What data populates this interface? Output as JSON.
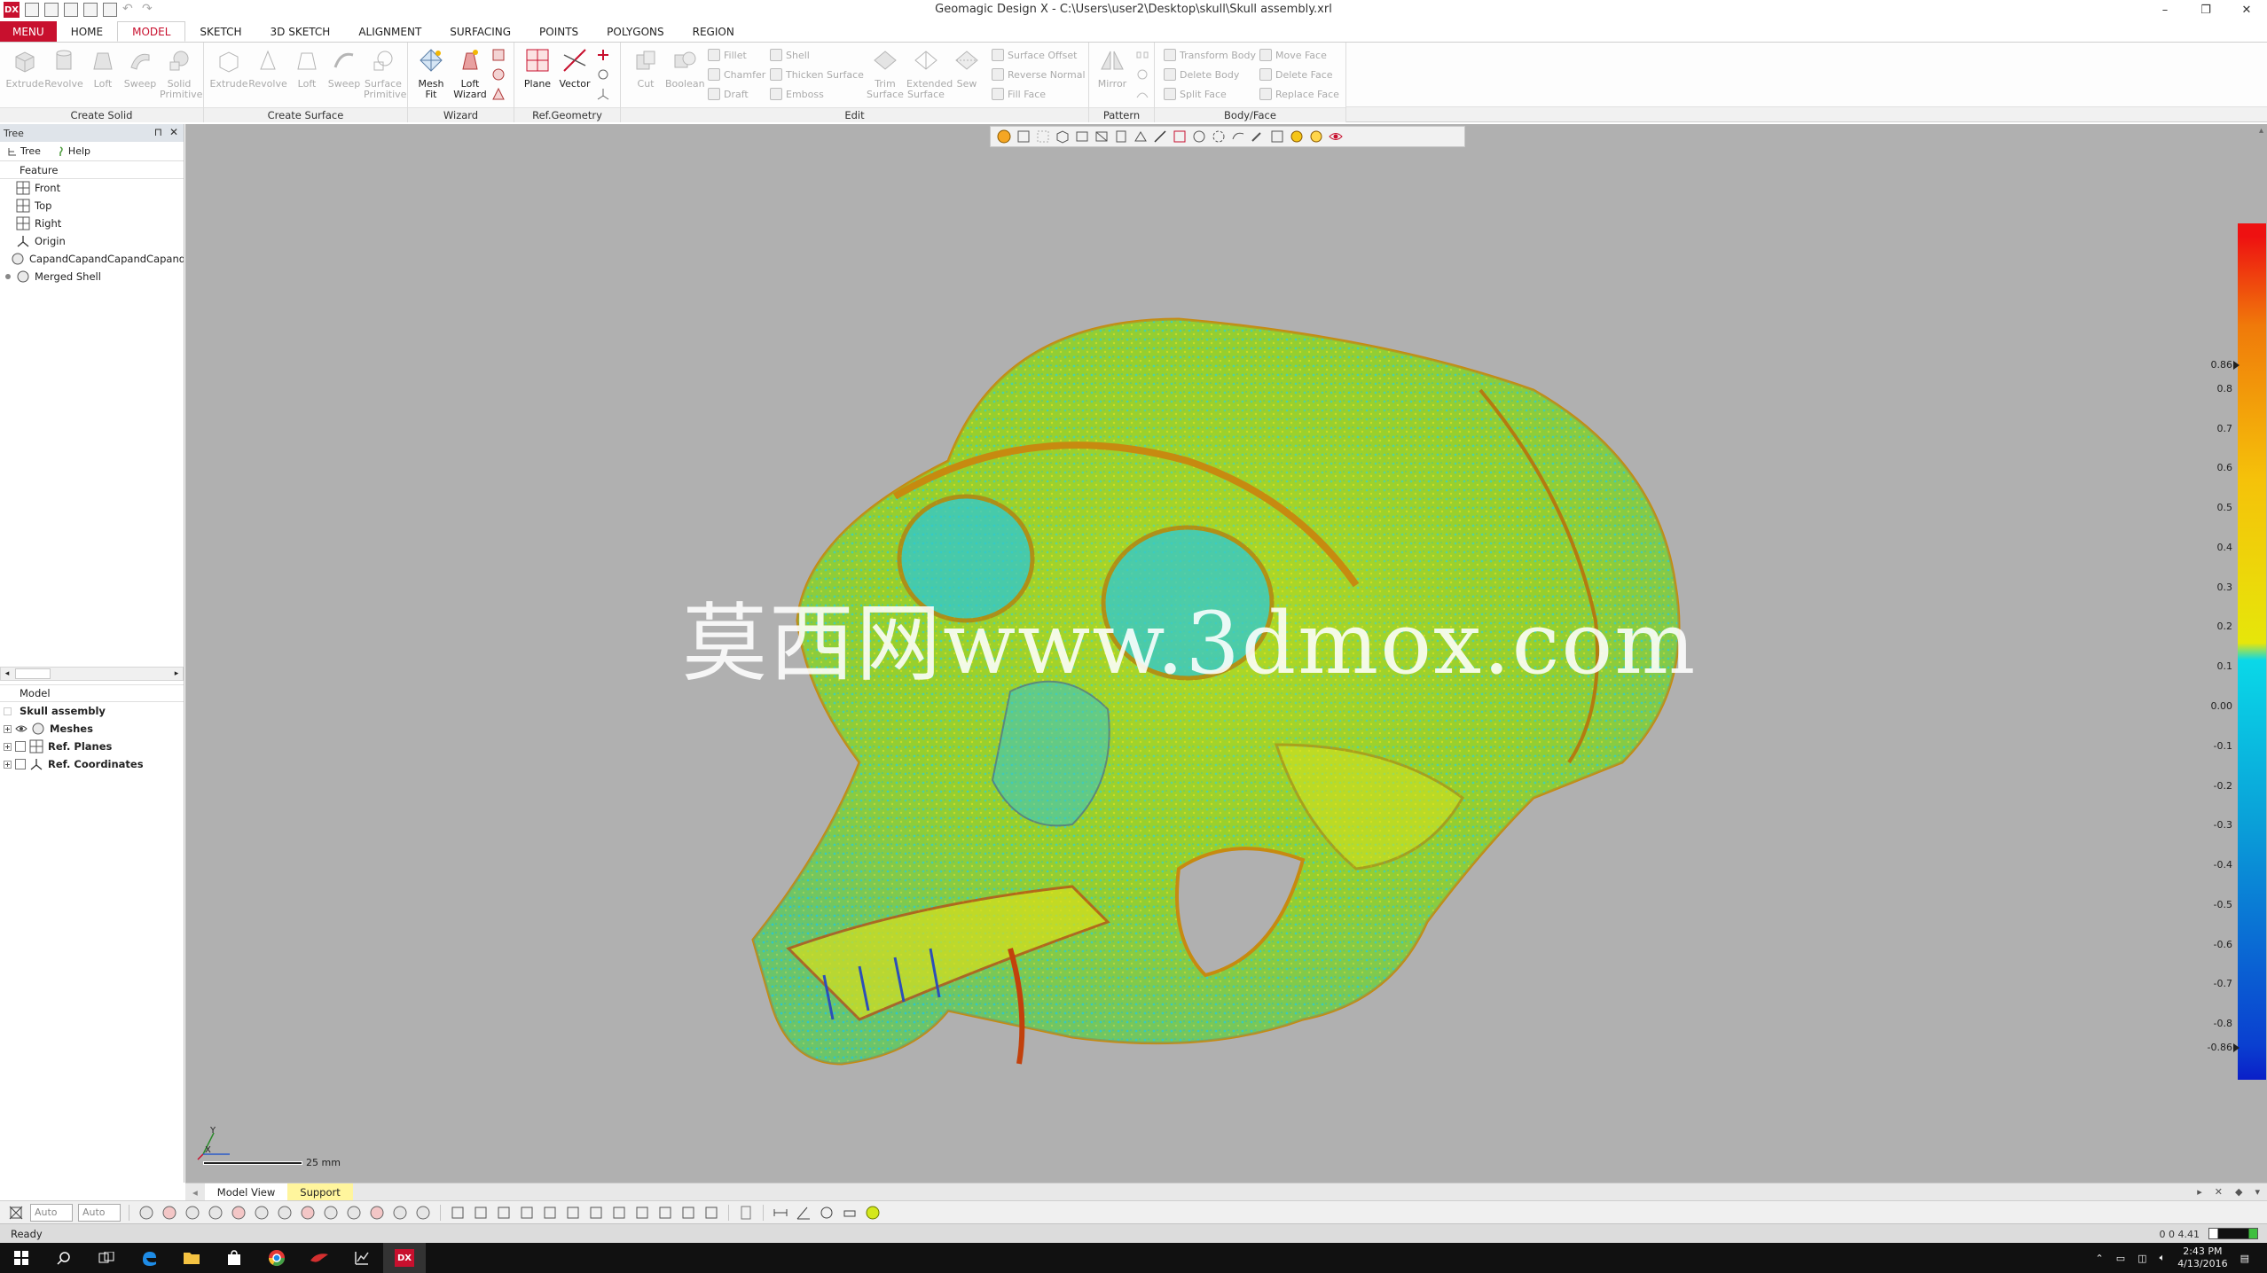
{
  "window": {
    "title": "Geomagic Design X - C:\\Users\\user2\\Desktop\\skull\\Skull assembly.xrl",
    "logo": "DX",
    "minimize": "–",
    "maximize": "❐",
    "close": "✕"
  },
  "menu": {
    "main": "MENU",
    "tabs": [
      "HOME",
      "MODEL",
      "SKETCH",
      "3D SKETCH",
      "ALIGNMENT",
      "SURFACING",
      "POINTS",
      "POLYGONS",
      "REGION"
    ],
    "active": "MODEL"
  },
  "ribbon": {
    "groups": {
      "create_solid": "Create Solid",
      "create_surface": "Create Surface",
      "wizard": "Wizard",
      "ref_geometry": "Ref.Geometry",
      "edit": "Edit",
      "pattern": "Pattern",
      "body_face": "Body/Face"
    },
    "create_solid": {
      "extrude": "Extrude",
      "revolve": "Revolve",
      "loft": "Loft",
      "sweep": "Sweep",
      "solid": "Solid",
      "primitive": "Primitive"
    },
    "create_surface": {
      "extrude": "Extrude",
      "revolve": "Revolve",
      "loft": "Loft",
      "sweep": "Sweep",
      "surface": "Surface",
      "primitive": "Primitive"
    },
    "wizard": {
      "mesh": "Mesh",
      "fit": "Fit",
      "loft": "Loft",
      "wizard": "Wizard"
    },
    "ref_geometry": {
      "plane": "Plane",
      "vector": "Vector"
    },
    "edit": {
      "cut": "Cut",
      "boolean": "Boolean",
      "fillet": "Fillet",
      "chamfer": "Chamfer",
      "draft": "Draft",
      "shell": "Shell",
      "thicken_surface": "Thicken Surface",
      "emboss": "Emboss",
      "trim": "Trim",
      "surface": "Surface",
      "extended": "Extended",
      "surface2": "Surface",
      "sew": "Sew",
      "surface_offset": "Surface Offset",
      "reverse_normal": "Reverse Normal",
      "fill_face": "Fill Face"
    },
    "pattern": {
      "mirror": "Mirror"
    },
    "body_face": {
      "transform_body": "Transform Body",
      "delete_body": "Delete Body",
      "split_face": "Split Face",
      "move_face": "Move Face",
      "delete_face": "Delete Face",
      "replace_face": "Replace Face"
    }
  },
  "left_panel": {
    "header": "Tree",
    "pin": "⊓",
    "close": "✕",
    "tabs": {
      "tree": "Tree",
      "help": "Help"
    },
    "feature_header": "Feature",
    "features": [
      "Front",
      "Top",
      "Right",
      "Origin",
      "CapandCapandCapandCapandCap",
      "Merged Shell"
    ],
    "model_header": "Model",
    "model_root": "Skull assembly",
    "model_items": [
      "Meshes",
      "Ref. Planes",
      "Ref. Coordinates"
    ]
  },
  "viewport": {
    "watermark": "莫西网www.3dmox.com",
    "scale_label": "25 mm",
    "axis": {
      "y": "Y",
      "x": "X"
    }
  },
  "legend": {
    "labels": [
      "0.86",
      "0.8",
      "0.7",
      "0.6",
      "0.5",
      "0.4",
      "0.3",
      "0.2",
      "0.1",
      "0.00",
      "-0.1",
      "-0.2",
      "-0.3",
      "-0.4",
      "-0.5",
      "-0.6",
      "-0.7",
      "-0.8",
      "-0.86"
    ],
    "values": [
      0.86,
      0.8,
      0.7,
      0.6,
      0.5,
      0.4,
      0.3,
      0.2,
      0.1,
      0.0,
      -0.1,
      -0.2,
      -0.3,
      -0.4,
      -0.5,
      -0.6,
      -0.7,
      -0.8,
      -0.86
    ],
    "colors": {
      "max": "#ee1111",
      "high": "#f07a0a",
      "mid_high": "#f5c20a",
      "zero_pos": "#e6e60a",
      "zero_neg": "#0ad8e8",
      "mid_low": "#0aa0d8",
      "low": "#0a3fd0",
      "min": "#0a1fc8"
    }
  },
  "view_tabs": [
    "Model View",
    "Support"
  ],
  "bottom_toolbar": {
    "auto1": "Auto",
    "auto2": "Auto"
  },
  "status": {
    "text": "Ready",
    "coords": "0 0 4.41"
  },
  "taskbar": {
    "time": "2:43 PM",
    "date": "4/13/2016",
    "app_label": "DX"
  },
  "colors": {
    "accent": "#c8102e",
    "viewport_bg": "#b0b0b0",
    "panel_header": "#dfe4ea"
  }
}
